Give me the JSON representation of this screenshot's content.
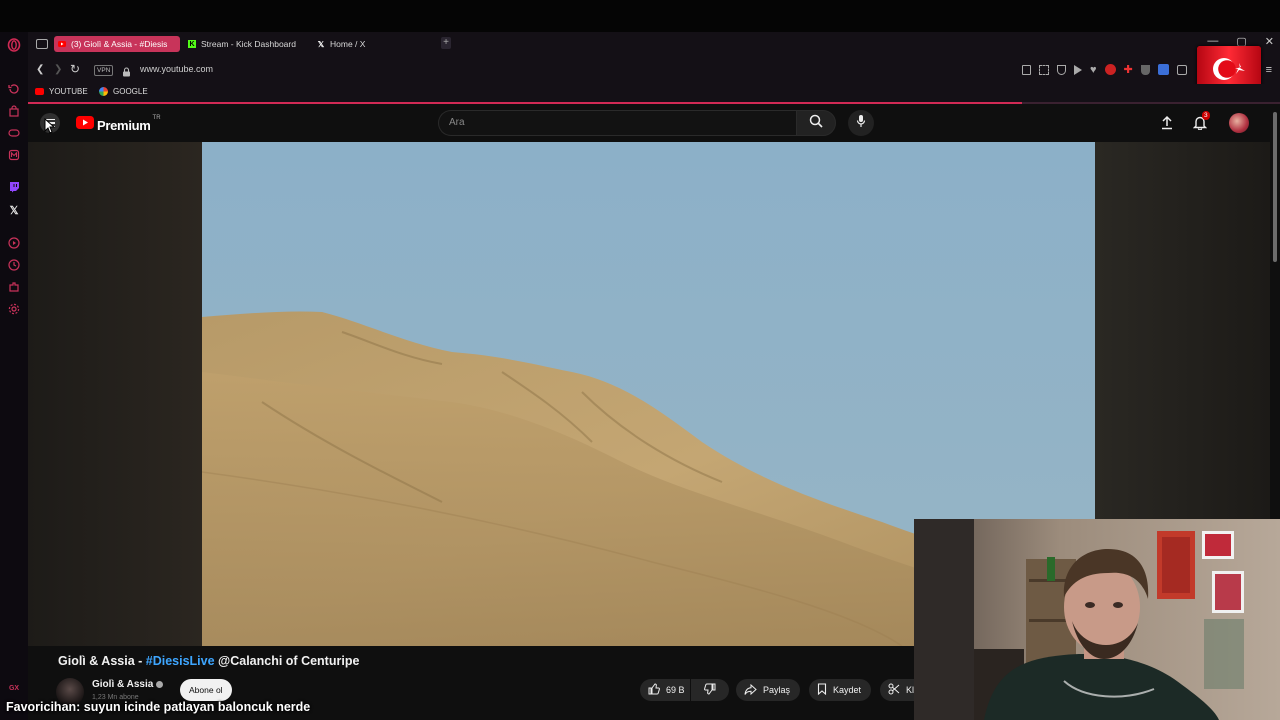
{
  "browser": {
    "tabs": [
      {
        "label": "(3) Giolì & Assia - #Diesis",
        "active": true,
        "icon": "youtube-icon"
      },
      {
        "label": "Stream - Kick Dashboard",
        "active": false,
        "icon": "kick-icon"
      },
      {
        "label": "Home / X",
        "active": false,
        "icon": "x-icon"
      }
    ],
    "new_tab": "+",
    "vpn_badge": "VPN",
    "url": "www.youtube.com",
    "bookmarks": [
      {
        "label": "YOUTUBE",
        "icon": "youtube-icon"
      },
      {
        "label": "GOOGLE",
        "icon": "google-icon"
      }
    ],
    "sidebar_bottom": "GX",
    "accent_color": "#d12a55"
  },
  "youtube": {
    "logo_text": "Premium",
    "logo_region": "TR",
    "search_placeholder": "Ara",
    "notification_count": "3",
    "video": {
      "title_prefix": "Giolì & Assia - ",
      "title_hashtag": "#DiesisLive",
      "title_suffix": " @Calanchi of Centuripe",
      "channel_name": "Giolì & Assia",
      "subscribers": "1,23 Mn abone",
      "subscribe_label": "Abone ol",
      "like_count": "69 B",
      "share_label": "Paylaş",
      "save_label": "Kaydet",
      "clip_label": "Kl"
    }
  },
  "chat": {
    "user": "Favoricihan",
    "message": " : suyun icinde patlayan baloncuk nerde"
  }
}
